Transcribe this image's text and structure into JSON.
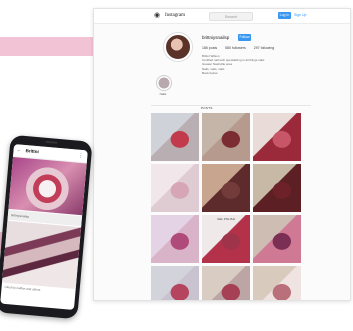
{
  "colors": {
    "accent_blue": "#3897f0",
    "stripe_pink": "#f2c3d4"
  },
  "desktop": {
    "topbar": {
      "icon": "instagram-camera-icon",
      "brand": "Instagram",
      "search_placeholder": "Search",
      "login_label": "Log In",
      "signup_label": "Sign Up"
    },
    "profile": {
      "username": "brittniysnailsp",
      "follow_label": "Follow",
      "stats": {
        "posts": "186 posts",
        "followers": "580 followers",
        "following": "297 following"
      },
      "bio_lines": [
        "Brittni Wilson",
        "Certified nail tech specializing in all things nails",
        "Greater Nashville area",
        "Nails, nails, nails",
        "Book below"
      ]
    },
    "highlight_label": "Nails",
    "tab_label": "POSTS",
    "grid": {
      "tiles": [
        {
          "c1": "#cfd2d8",
          "c2": "#c23b4c",
          "c3": "#b9aeb2"
        },
        {
          "c1": "#c5b5a9",
          "c2": "#7a2c32",
          "c3": "#b69a8e"
        },
        {
          "c1": "#e9dcd8",
          "c2": "#c65668",
          "c3": "#9a2a3a"
        },
        {
          "c1": "#f1e6ea",
          "c2": "#d6a6b7",
          "c3": "#dfccd2"
        },
        {
          "c1": "#c7a58e",
          "c2": "#733c3a",
          "c3": "#5e2b2d"
        },
        {
          "c1": "#c8b9a6",
          "c2": "#6d2229",
          "c3": "#5c2024"
        },
        {
          "c1": "#e4d2e5",
          "c2": "#b04a7b",
          "c3": "#d9b4c8"
        },
        {
          "c1": "#efe9ea",
          "c2": "#9f3349",
          "c3": "#b3324a"
        },
        {
          "c1": "#cdbdb3",
          "c2": "#7c2f54",
          "c3": "#d07994"
        },
        {
          "c1": "#d3d3dc",
          "c2": "#b5445e",
          "c3": "#c9c3cf"
        },
        {
          "c1": "#d9ccc3",
          "c2": "#a64055",
          "c3": "#bca5a5"
        },
        {
          "c1": "#d8cbbd",
          "c2": "#b9707a",
          "c3": "#efe4e1"
        }
      ],
      "tile_label": "GEL POLISH"
    }
  },
  "phone": {
    "title": "Brittni",
    "back_icon": "back-arrow-icon",
    "menu_icon": "more-dots-icon",
    "strip_text": "brittniysnailsp",
    "caption": "Liked by nailfan and others"
  }
}
